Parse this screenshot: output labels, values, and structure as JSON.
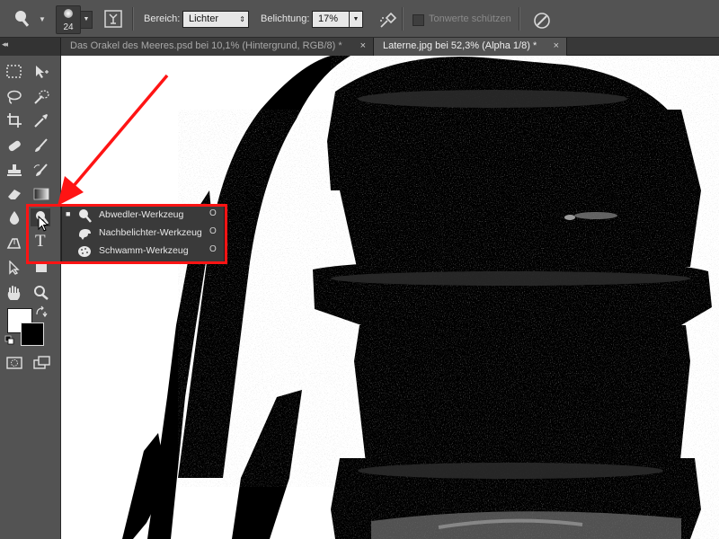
{
  "options_bar": {
    "tool_icon": "dodge-tool-icon",
    "brush_size": "24",
    "range_label": "Bereich:",
    "range_value": "Lichter",
    "exposure_label": "Belichtung:",
    "exposure_value": "17%",
    "airbrush_icon": "airbrush-icon",
    "protect_tones_label": "Tonwerte schützen",
    "protect_tones_checked": false,
    "pressure_icon": "pressure-size-icon"
  },
  "tabs": [
    {
      "label": "Das Orakel des Meeres.psd bei 10,1% (Hintergrund, RGB/8) *",
      "active": false,
      "close": "×"
    },
    {
      "label": "Laterne.jpg bei 52,3% (Alpha 1/8) *",
      "active": true,
      "close": "×"
    }
  ],
  "panel_collapse_glyph": "◂◂",
  "toolbox": {
    "tools": [
      "marquee-icon",
      "move-icon",
      "lasso-icon",
      "quick-selection-icon",
      "crop-icon",
      "eyedropper-icon",
      "healing-brush-icon",
      "brush-icon",
      "clone-stamp-icon",
      "history-brush-icon",
      "eraser-icon",
      "gradient-icon",
      "blur-icon",
      "dodge-icon",
      "pen-icon",
      "type-icon",
      "path-selection-icon",
      "rectangle-icon",
      "hand-icon",
      "zoom-icon"
    ],
    "type_glyph": "T",
    "foreground_color": "#ffffff",
    "background_color": "#000000"
  },
  "flyout": {
    "items": [
      {
        "label": "Abwedler-Werkzeug",
        "shortcut": "O",
        "selected": true,
        "icon": "dodge-icon"
      },
      {
        "label": "Nachbelichter-Werkzeug",
        "shortcut": "O",
        "selected": false,
        "icon": "burn-icon"
      },
      {
        "label": "Schwamm-Werkzeug",
        "shortcut": "O",
        "selected": false,
        "icon": "sponge-icon"
      }
    ],
    "bullet": "■"
  },
  "annotation": {
    "highlight_color": "#ff1414"
  }
}
